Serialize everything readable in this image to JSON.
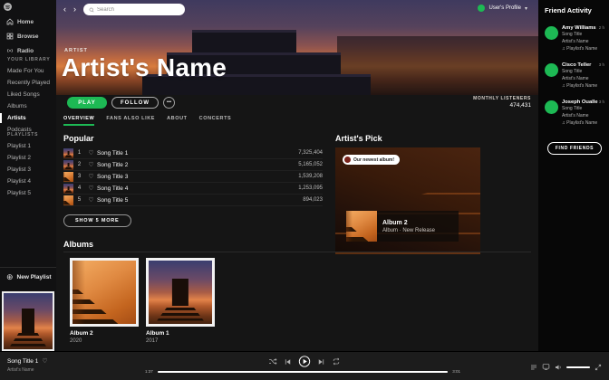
{
  "colors": {
    "accent_green": "#1db954",
    "banner_orange": "#d87c3e",
    "sidebar_bg": "#111112",
    "player_bg": "#1c1c1c"
  },
  "sidebar": {
    "nav": [
      {
        "icon": "home-icon",
        "label": "Home"
      },
      {
        "icon": "browse-icon",
        "label": "Browse"
      },
      {
        "icon": "radio-icon",
        "label": "Radio"
      }
    ],
    "library_header": "YOUR LIBRARY",
    "library_items": [
      "Made For You",
      "Recently Played",
      "Liked Songs",
      "Albums",
      "Artists",
      "Podcasts"
    ],
    "active_library_item": "Artists",
    "playlists_header": "PLAYLISTS",
    "playlists": [
      "Playlist 1",
      "Playlist 2",
      "Playlist 3",
      "Playlist 4",
      "Playlist 5"
    ],
    "new_playlist_label": "New Playlist"
  },
  "topbar": {
    "back_glyph": "‹",
    "forward_glyph": "›",
    "search_placeholder": "Search",
    "user_label": "User's Profile",
    "user_caret": "▾"
  },
  "banner": {
    "kicker": "ARTIST",
    "title": "Artist's Name"
  },
  "actions": {
    "play_label": "PLAY",
    "follow_label": "FOLLOW",
    "more_label": "•••",
    "monthly_listeners_label": "MONTHLY LISTENERS",
    "monthly_listeners_value": "474,431"
  },
  "tabs": [
    "OVERVIEW",
    "FANS ALSO LIKE",
    "ABOUT",
    "CONCERTS"
  ],
  "popular": {
    "heading": "Popular",
    "show_more_label": "SHOW 5 MORE",
    "heart_glyph": "♡",
    "songs": [
      {
        "index": "1",
        "title": "Song Title 1",
        "plays": "7,325,404"
      },
      {
        "index": "2",
        "title": "Song Title 2",
        "plays": "5,165,052"
      },
      {
        "index": "3",
        "title": "Song Title 3",
        "plays": "1,539,208"
      },
      {
        "index": "4",
        "title": "Song Title 4",
        "plays": "1,253,095"
      },
      {
        "index": "5",
        "title": "Song Title 5",
        "plays": "894,023"
      }
    ]
  },
  "artists_pick": {
    "heading": "Artist's Pick",
    "badge_label": "Our newest album!",
    "album_title": "Album 2",
    "album_subtitle": "Album · New Release"
  },
  "albums": {
    "heading": "Albums",
    "items": [
      {
        "title": "Album 2",
        "year": "2020"
      },
      {
        "title": "Album 1",
        "year": "2017"
      }
    ]
  },
  "friend_activity": {
    "heading": "Friend Activity",
    "find_friends_label": "FIND FRIENDS",
    "note_glyph": "♫",
    "friends": [
      {
        "name": "Amy Williams",
        "time": "2 h",
        "song": "Song Title",
        "artist": "Artist's Name",
        "playlist": "Playlist's Name"
      },
      {
        "name": "Cisco Teller",
        "time": "3 h",
        "song": "Song Title",
        "artist": "Artist's Name",
        "playlist": "Playlist's Name"
      },
      {
        "name": "Joseph Oualle",
        "time": "3 h",
        "song": "Song Title",
        "artist": "Artist's Name",
        "playlist": "Playlist's Name"
      }
    ]
  },
  "player": {
    "song_title": "Song Title 1",
    "heart_glyph": "♡",
    "artist_name": "Artist's Name",
    "elapsed": "1:37",
    "duration": "3:01",
    "progress_percent": 100,
    "volume_percent": 100
  }
}
